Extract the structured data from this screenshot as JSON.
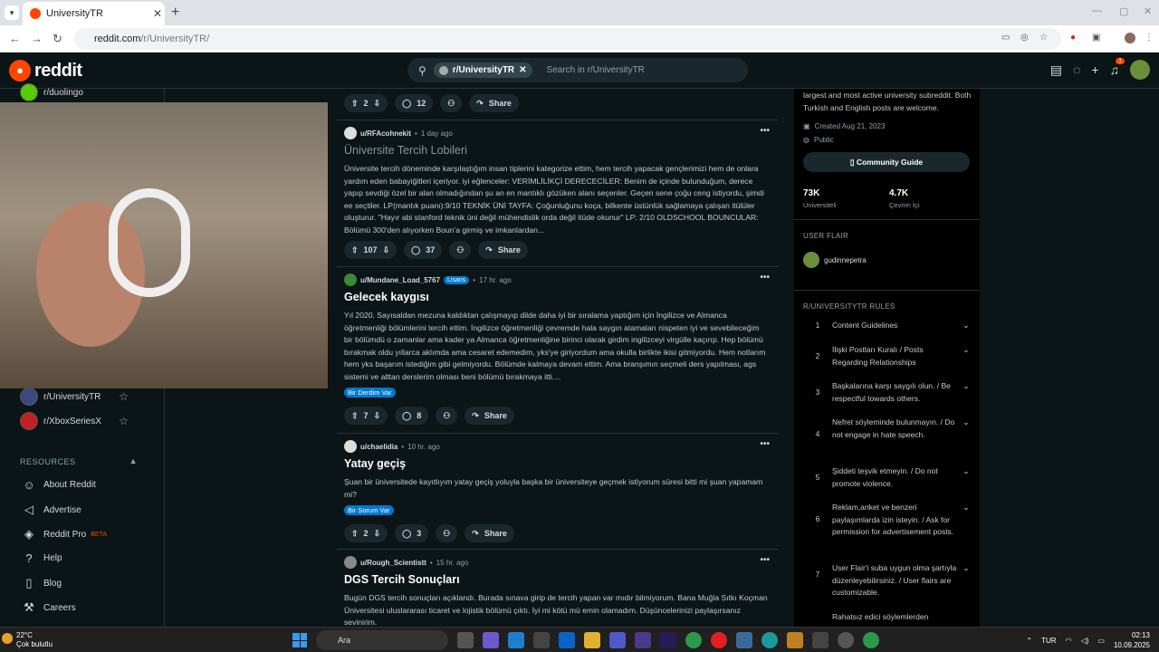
{
  "browser": {
    "tab_title": "UniversityTR",
    "url_host": "reddit.com",
    "url_path": "/r/UniversityTR/"
  },
  "header": {
    "logo": "reddit",
    "search_chip": "r/UniversityTR",
    "search_placeholder": "Search in r/UniversityTR",
    "notif_count": "1"
  },
  "sidebar": {
    "top_community": "r/duolingo",
    "communities": [
      {
        "name": "r/UniversityTR"
      },
      {
        "name": "r/XboxSeriesX"
      }
    ],
    "resources_heading": "RESOURCES",
    "resources": [
      {
        "label": "About Reddit",
        "icon": "reddit-icon"
      },
      {
        "label": "Advertise",
        "icon": "megaphone-icon"
      },
      {
        "label": "Reddit Pro",
        "icon": "pro-icon",
        "badge": "BETA"
      },
      {
        "label": "Help",
        "icon": "help-icon"
      },
      {
        "label": "Blog",
        "icon": "book-icon"
      },
      {
        "label": "Careers",
        "icon": "wrench-icon"
      }
    ]
  },
  "feed": {
    "top_actions": {
      "votes": "2",
      "comments": "12",
      "share": "Share"
    },
    "posts": [
      {
        "user": "u/RFAcohnekit",
        "time": "1 day ago",
        "title": "Üniversite Tercih Lobileri",
        "body": "Üniversite tercih döneminde karşılaştığım insan tiplerini kategorize ettim, hem tercih yapacak gençlerimizi hem de onlara yardım eden babayiğitleri içeriyor. iyi eğlenceler: VERİMLİLİKÇİ DERECECİLER: Benim de içinde bulunduğum, derece yapıp sevdiği özel bir alan olmadığından şu an en mantıklı gözüken alanı seçenler. Geçen sene çoğu ceng istiyordu, şimdi ee seçtiler. LP(mantık puanı):9/10 TEKNİK ÜNİ TAYFA: Çoğunluğunu koça, bilkente üstünlük sağlamaya çalışan itülüler oluşturur. \"Hayır abi stanford teknik üni değil mühendislik orda değil itüde okunur\" LP: 2/10 OLDSCHOOL BOUNCULAR: Bölümü 300'den alıyorken Boun'a girmiş ve imkanlardan...",
        "votes": "107",
        "comments": "37",
        "share": "Share"
      },
      {
        "user": "u/Mundane_Load_5767",
        "user_flair": "Lisans",
        "time": "17 hr. ago",
        "title": "Gelecek kaygısı",
        "body": "Yıl 2020. Sayısaldan mezuna kaldıktan çalışmayıp dilde daha iyi bir sıralama yaptığım için İngilizce ve Almanca öğretmenliği bölümlerini tercih ettim. İngilizce öğretmenliği çevremde hala saygın atamaları nispeten iyi ve sevebileceğim bir bölümdü o zamanlar ama kader ya Almanca öğretmenliğine birinci olarak girdim ingilizceyi virgülle kaçırıp. Hep bölümü bırakmak oldu yıllarca aklımda ama cesaret edemedim, yks'ye giriyordum ama okulla birlikte ikisi gitmiyordu. Hem notlarım hem yks başarım istediğim gibi gelmiyordu. Bölümde kalmaya devam ettim. Ama branşımın seçmeli ders yapılması, ags sistemi ve alttan derslerim olması beni bölümü bırakmaya itti....",
        "flair": "Bir Derdim Var",
        "votes": "7",
        "comments": "8",
        "share": "Share"
      },
      {
        "user": "u/chaelidia",
        "time": "10 hr. ago",
        "title": "Yatay geçiş",
        "body": "Şuan bir üniversitede kayıtlıyım yatay geçiş yoluyla başka bir üniversiteye geçmek istiyorum süresi bitti mi şuan yapamam mi?",
        "flair": "Bir Sorum Var",
        "votes": "2",
        "comments": "3",
        "share": "Share"
      },
      {
        "user": "u/Rough_Scientistt",
        "time": "15 hr. ago",
        "title": "DGS Tercih Sonuçları",
        "body": "Bugün DGS tercih sonuçları açıklandı. Burada sınava girip de tercih yapan var mıdır bilmiyorum. Bana Muğla Sıtkı Koçman Üniversitesi uluslararası ticaret ve lojistik bölümü çıktı. İyi mi kötü mü emin olamadım. Düşüncelerinizi paylaşırsanız sevinirim."
      }
    ]
  },
  "right": {
    "desc": "largest and most active university subreddit. Both Turkish and English posts are welcome.",
    "created": "Created Aug 21, 2023",
    "visibility": "Public",
    "guide": "Community Guide",
    "members": "73K",
    "members_label": "Üniversiteli",
    "online": "4.7K",
    "online_label": "Çevrim İçi",
    "flair_heading": "USER FLAIR",
    "flair_user": "gudinnepetra",
    "rules_heading": "R/UNIVERSITYTR RULES",
    "rules": [
      {
        "n": "1",
        "t": "Content Guidelines"
      },
      {
        "n": "2",
        "t": "İlişki Postları Kuralı / Posts Regarding Relationships"
      },
      {
        "n": "3",
        "t": "Başkalarına karşı saygılı olun. / Be respectful towards others."
      },
      {
        "n": "4",
        "t": "Nefret söyleminde bulunmayın. / Do not engage in hate speech."
      },
      {
        "n": "5",
        "t": "Şiddeti teşvik etmeyin. / Do not promote violence."
      },
      {
        "n": "6",
        "t": "Reklam,anket ve benzeri paylaşımlarda izin isteyin. / Ask for permission for advertisement posts."
      },
      {
        "n": "7",
        "t": "User Flair'i suba uygun olma şartıyla düzenleyebilirsiniz. / User flairs are customizable."
      },
      {
        "n": "",
        "t": "Rahatsız edici söylemlerden"
      }
    ]
  },
  "taskbar": {
    "temp": "22°C",
    "weather": "Çok bulutlu",
    "search": "Ara",
    "lang": "TUR",
    "time": "02:13",
    "date": "10.09.2025"
  }
}
